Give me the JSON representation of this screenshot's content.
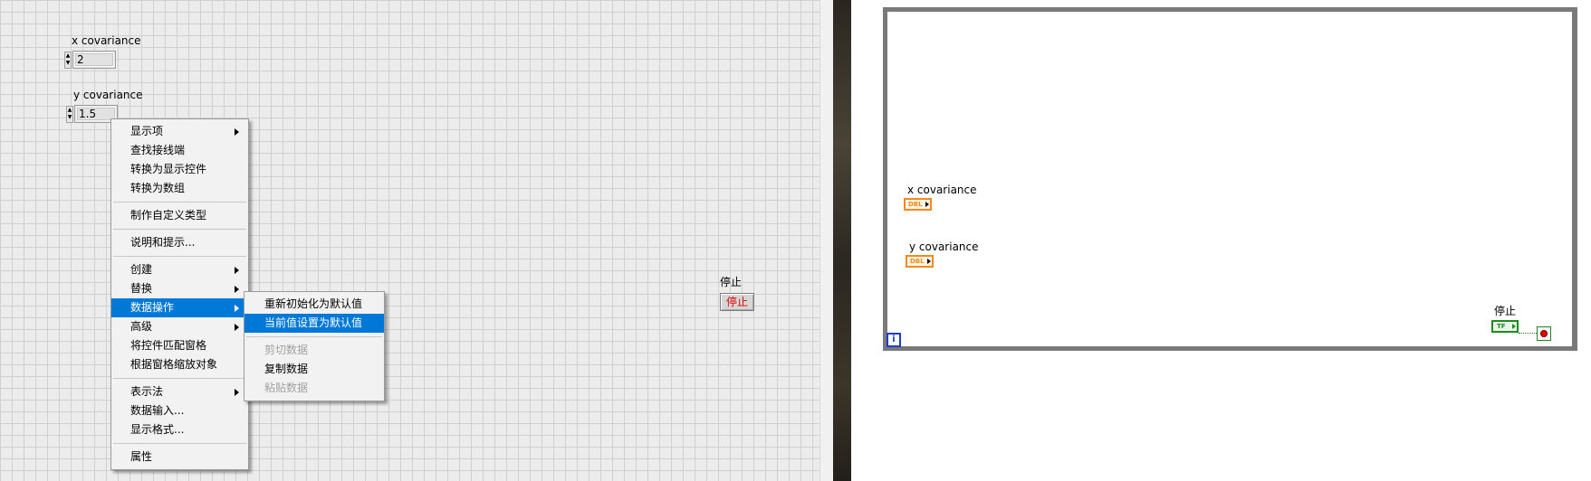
{
  "front_panel": {
    "x_covariance": {
      "label": "x covariance",
      "value": "2"
    },
    "y_covariance": {
      "label": "y covariance",
      "value": "1.5"
    },
    "stop": {
      "label": "停止",
      "button_text": "停止"
    }
  },
  "context_menu": {
    "items": [
      {
        "label": "显示项",
        "submenu": true
      },
      {
        "label": "查找接线端"
      },
      {
        "label": "转换为显示控件"
      },
      {
        "label": "转换为数组"
      },
      {
        "label": "制作自定义类型"
      },
      {
        "label": "说明和提示..."
      },
      {
        "label": "创建",
        "submenu": true
      },
      {
        "label": "替换",
        "submenu": true
      },
      {
        "label": "数据操作",
        "submenu": true,
        "highlighted": true
      },
      {
        "label": "高级",
        "submenu": true
      },
      {
        "label": "将控件匹配窗格"
      },
      {
        "label": "根据窗格缩放对象"
      },
      {
        "label": "表示法",
        "submenu": true
      },
      {
        "label": "数据输入..."
      },
      {
        "label": "显示格式..."
      },
      {
        "label": "属性"
      }
    ]
  },
  "submenu": {
    "items": [
      {
        "label": "重新初始化为默认值"
      },
      {
        "label": "当前值设置为默认值",
        "highlighted": true
      },
      {
        "label": "剪切数据",
        "disabled": true
      },
      {
        "label": "复制数据"
      },
      {
        "label": "粘贴数据",
        "disabled": true
      }
    ]
  },
  "block_diagram": {
    "x_covariance_label": "x covariance",
    "x_covariance_type": "DBL",
    "y_covariance_label": "y covariance",
    "y_covariance_type": "DBL",
    "stop_label": "停止",
    "stop_type": "TF",
    "iteration_label": "i"
  },
  "colors": {
    "highlight": "#0078d7",
    "terminal_dbl": "#f28a1d",
    "terminal_bool": "#1f8a1f",
    "stop_text": "#e00000"
  }
}
